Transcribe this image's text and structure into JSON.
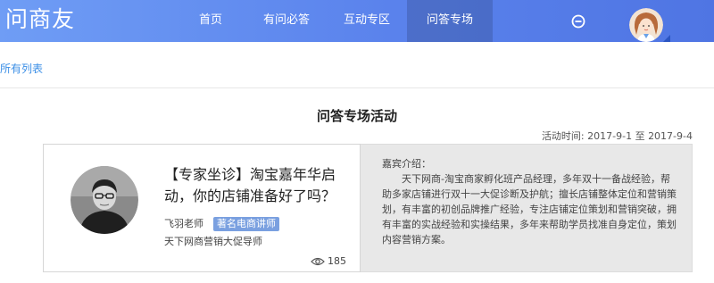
{
  "header": {
    "logo": "问商友",
    "nav": [
      {
        "label": "首页"
      },
      {
        "label": "有问必答"
      },
      {
        "label": "互动专区"
      },
      {
        "label": "问答专场"
      }
    ],
    "active_nav": "问答专场",
    "brand_color": "#5a82ec"
  },
  "breadcrumb": {
    "link": "所有列表"
  },
  "page": {
    "title": "问答专场活动",
    "activity_time": "活动时间: 2017-9-1 至 2017-9-4"
  },
  "card": {
    "title": "【专家坐诊】淘宝嘉年华启动，你的店铺准备好了吗？",
    "author": "飞羽老师",
    "badge": "著名电商讲师",
    "role": "天下网商营销大促导师",
    "views": "185",
    "guest_label": "嘉宾介绍：",
    "guest_intro": "天下网商-淘宝商家孵化班产品经理，多年双十一备战经验，帮助多家店铺进行双十一大促诊断及护航；擅长店铺整体定位和营销策划，有丰富的初创品牌推广经验，专注店铺定位策划和营销突破，拥有丰富的实战经验和实操结果，多年来帮助学员找准自身定位，策划内容营销方案。"
  },
  "icons": [
    "minus-circle-icon",
    "user-avatar",
    "eye-icon"
  ]
}
